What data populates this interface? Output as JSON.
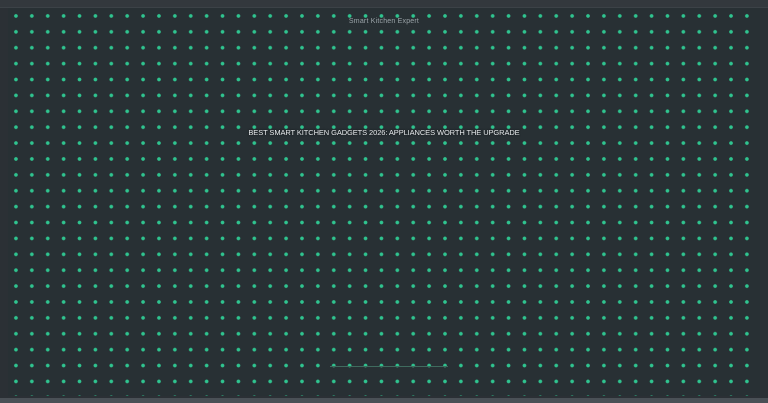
{
  "site": {
    "name": "Smart Kitchen Expert"
  },
  "hero": {
    "headline": "BEST SMART KITCHEN GADGETS 2026: APPLIANCES WORTH THE UPGRADE"
  },
  "colors": {
    "background": "#2b3035",
    "dot_accent": "#2fc48f",
    "headline_text": "#e8ecee",
    "site_label_text": "#9aa3a8"
  }
}
